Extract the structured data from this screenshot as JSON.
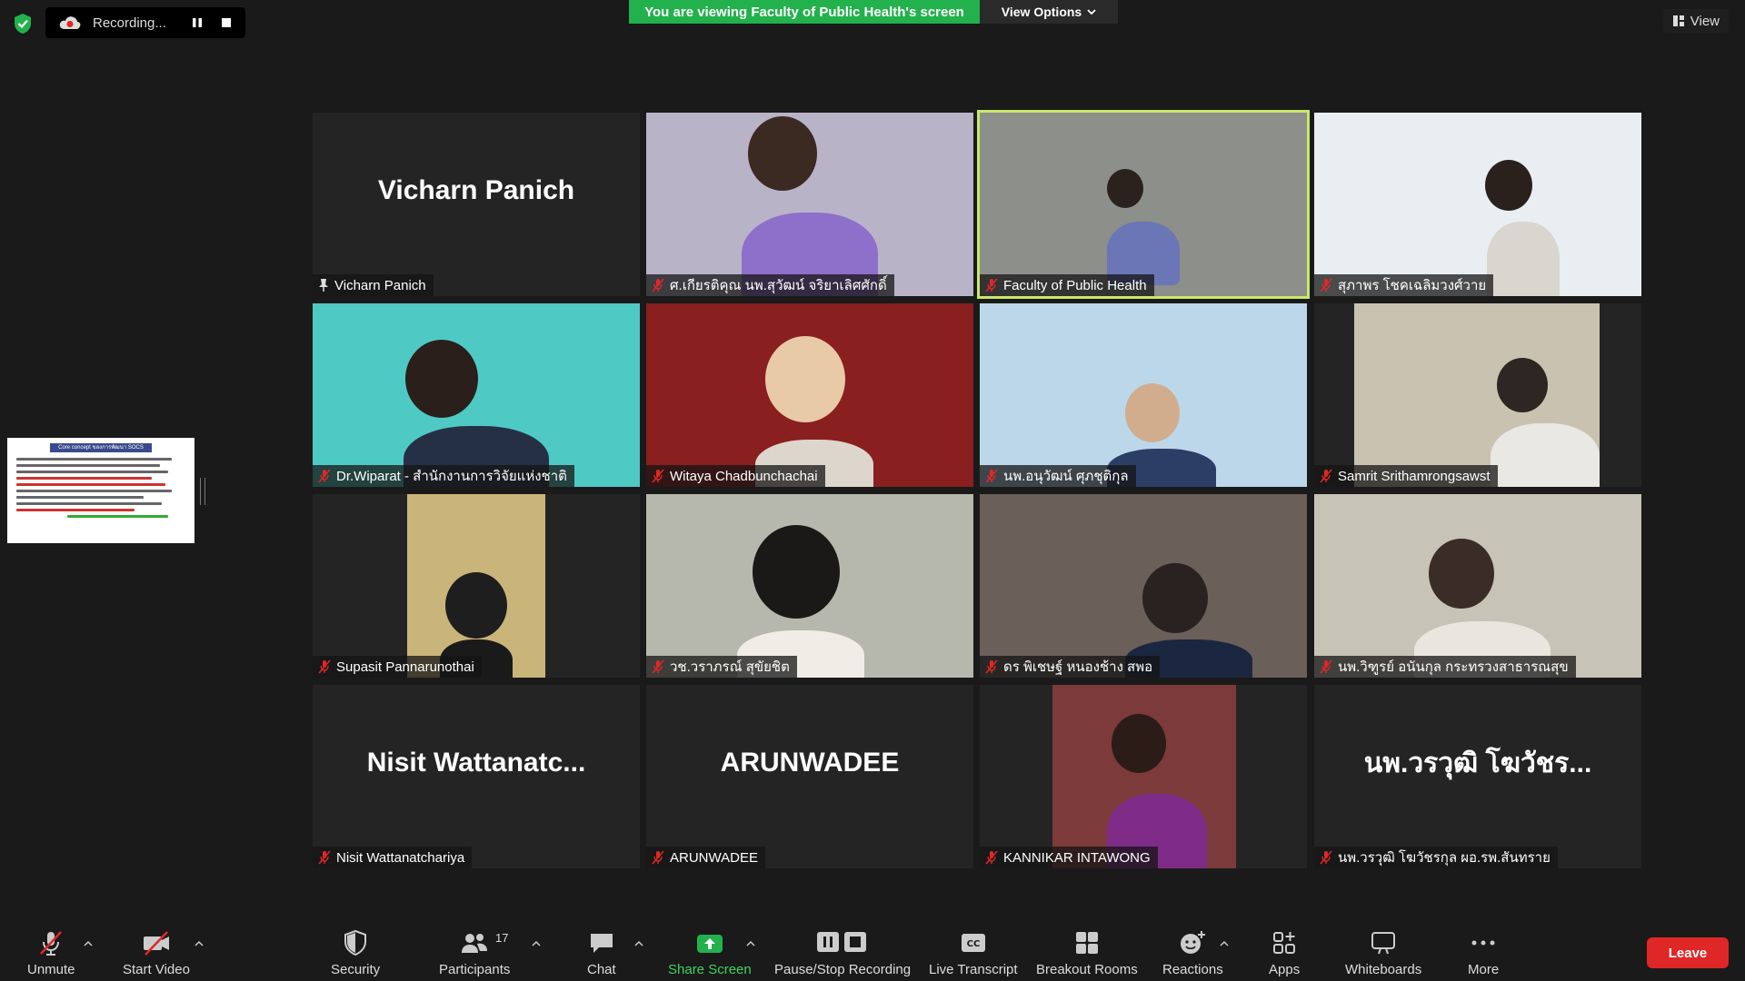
{
  "top": {
    "recording_label": "Recording...",
    "viewing_banner": "You are viewing Faculty of Public Health's screen",
    "view_options": "View Options",
    "view_label": "View"
  },
  "slide": {
    "title": "Core concept ของการพัฒนา SOCS"
  },
  "tiles": [
    {
      "label": "Vicharn Panich",
      "big_name": "Vicharn Panich",
      "has_video": false,
      "pinned": true
    },
    {
      "label": "ศ.เกียรติคุณ นพ.สุวัฒน์ จริยาเลิศศักดิ์",
      "has_video": true,
      "bg": "#b9b3c8"
    },
    {
      "label": "Faculty of Public Health",
      "has_video": true,
      "bg": "#8c8f8a",
      "active": true
    },
    {
      "label": "สุภาพร โชคเฉลิมวงศ์วาย",
      "has_video": true,
      "bg": "#e8eef2"
    },
    {
      "label": "Dr.Wiparat - สำนักงานการวิจัยแห่งชาติ",
      "has_video": true,
      "bg": "#4fc9c4"
    },
    {
      "label": "Witaya Chadbunchachai",
      "has_video": true,
      "bg": "#8a1f1f"
    },
    {
      "label": "นพ.อนุวัฒน์ ศุภชุติกุล",
      "has_video": true,
      "bg": "#bcd7ea"
    },
    {
      "label": "Samrit Srithamrongsawst",
      "has_video": true,
      "bg": "#c9c2b0"
    },
    {
      "label": "Supasit Pannarunothai",
      "has_video": true,
      "bg": "#c9b57a"
    },
    {
      "label": "วช.วราภรณ์ สุขัยชิต",
      "has_video": true,
      "bg": "#b7b8ad"
    },
    {
      "label": "ดร พิเชษฐ์ หนองช้าง สพอ",
      "has_video": true,
      "bg": "#6a5f59"
    },
    {
      "label": "นพ.วิฑูรย์ อนันกุล กระทรวงสาธารณสุข",
      "has_video": true,
      "bg": "#c8c3b7"
    },
    {
      "label": "Nisit Wattanatchariya",
      "big_name": "Nisit  Wattanatc...",
      "has_video": false
    },
    {
      "label": "ARUNWADEE",
      "big_name": "ARUNWADEE",
      "has_video": false
    },
    {
      "label": "KANNIKAR INTAWONG",
      "has_video": true,
      "bg": "#7c3a3a"
    },
    {
      "label": "นพ.วรวุฒิ โฆวัชรกุล ผอ.รพ.สันทราย",
      "big_name": "นพ.วรวุฒิ โฆวัชร...",
      "has_video": false
    }
  ],
  "toolbar": {
    "unmute": "Unmute",
    "start_video": "Start Video",
    "security": "Security",
    "participants": "Participants",
    "participants_count": "17",
    "chat": "Chat",
    "share_screen": "Share Screen",
    "pause_stop_recording": "Pause/Stop Recording",
    "live_transcript": "Live Transcript",
    "breakout_rooms": "Breakout Rooms",
    "reactions": "Reactions",
    "apps": "Apps",
    "whiteboards": "Whiteboards",
    "more": "More",
    "leave": "Leave"
  },
  "colors": {
    "accent_green": "#23b14d",
    "leave_red": "#e02727",
    "active_border": "#c9e86a"
  }
}
